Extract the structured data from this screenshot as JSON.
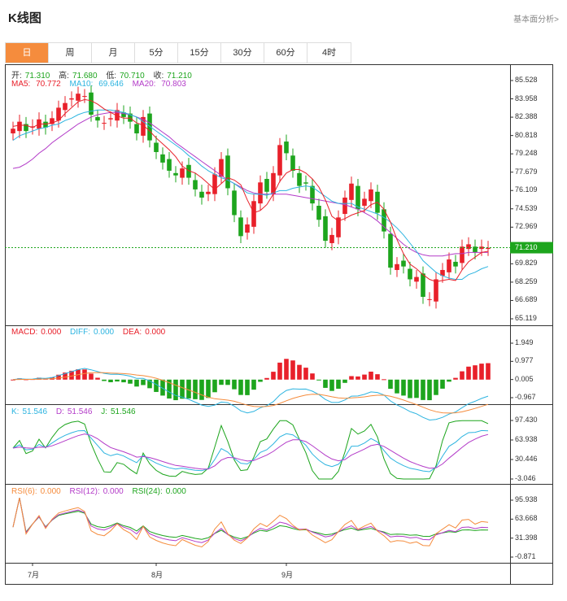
{
  "header": {
    "title": "K线图",
    "link": "基本面分析>"
  },
  "tabs": [
    "日",
    "周",
    "月",
    "5分",
    "15分",
    "30分",
    "60分",
    "4时"
  ],
  "active_tab": "日",
  "ohlc_info": {
    "open_label": "开:",
    "open": "71.310",
    "high_label": "高:",
    "high": "71.680",
    "low_label": "低:",
    "low": "70.710",
    "close_label": "收:",
    "close": "71.210"
  },
  "ma_info": {
    "ma5_label": "MA5:",
    "ma5": "70.772",
    "ma10_label": "MA10:",
    "ma10": "69.646",
    "ma20_label": "MA20:",
    "ma20": "70.803"
  },
  "macd_info": {
    "macd_label": "MACD:",
    "macd": "0.000",
    "diff_label": "DIFF:",
    "diff": "0.000",
    "dea_label": "DEA:",
    "dea": "0.000"
  },
  "kdj_info": {
    "k_label": "K:",
    "k": "51.546",
    "d_label": "D:",
    "d": "51.546",
    "j_label": "J:",
    "j": "51.546"
  },
  "rsi_info": {
    "rsi6_label": "RSI(6):",
    "rsi6": "0.000",
    "rsi12_label": "RSI(12):",
    "rsi12": "0.000",
    "rsi24_label": "RSI(24):",
    "rsi24": "0.000"
  },
  "price_axis": [
    "85.528",
    "83.958",
    "82.388",
    "80.818",
    "79.248",
    "77.679",
    "76.109",
    "74.539",
    "72.969",
    "69.829",
    "68.259",
    "66.689",
    "65.119"
  ],
  "current_price": "71.210",
  "macd_axis": [
    "1.949",
    "0.977",
    "0.005",
    "-0.967"
  ],
  "kdj_axis": [
    "97.430",
    "63.938",
    "30.446",
    "-3.046"
  ],
  "rsi_axis": [
    "95.938",
    "63.668",
    "31.398",
    "-0.871"
  ],
  "x_labels": [
    "7月",
    "8月",
    "9月"
  ],
  "colors": {
    "up": "#e8202a",
    "down": "#1da51d",
    "ma5": "#e8202a",
    "ma10": "#2db4e0",
    "ma20": "#b33bc8",
    "accent": "#f58c3d"
  },
  "chart_data": {
    "type": "candlestick",
    "close": [
      81.4,
      82.0,
      81.2,
      81.6,
      82.2,
      81.5,
      82.3,
      83.2,
      83.6,
      84.0,
      84.4,
      84.2,
      82.6,
      82.1,
      81.9,
      82.3,
      83.0,
      82.4,
      82.0,
      81.0,
      82.4,
      80.4,
      79.4,
      78.5,
      77.8,
      77.4,
      78.0,
      77.2,
      76.2,
      75.5,
      76.0,
      77.5,
      78.8,
      76.3,
      74.0,
      72.2,
      73.2,
      75.2,
      76.8,
      76.0,
      77.6,
      80.0,
      79.3,
      77.8,
      76.5,
      76.7,
      75.0,
      73.6,
      71.8,
      72.3,
      73.8,
      75.5,
      76.7,
      74.5,
      75.4,
      76.2,
      74.2,
      72.6,
      69.5,
      69.8,
      69.6,
      68.5,
      68.7,
      67.0,
      66.8,
      68.5,
      69.3,
      70.2,
      69.6,
      71.3,
      71.5,
      70.8,
      71.3,
      71.2
    ],
    "ma5": [
      81.6,
      81.7,
      81.7,
      81.5,
      81.8,
      81.8,
      81.9,
      82.1,
      82.7,
      83.2,
      83.7,
      83.9,
      83.8,
      83.5,
      83.1,
      82.8,
      82.5,
      82.3,
      82.3,
      81.9,
      81.7,
      81.2,
      80.6,
      80.1,
      79.6,
      79.0,
      78.2,
      77.8,
      77.6,
      77.2,
      76.7,
      76.2,
      76.7,
      77.2,
      77.0,
      76.6,
      75.3,
      74.2,
      74.4,
      74.9,
      75.8,
      76.9,
      77.6,
      77.9,
      77.9,
      77.6,
      77.1,
      76.4,
      75.3,
      73.9,
      73.5,
      73.7,
      74.0,
      74.2,
      74.4,
      74.9,
      75.1,
      74.5,
      73.4,
      71.9,
      70.7,
      69.8,
      69.4,
      68.9,
      68.5,
      68.3,
      68.4,
      68.5,
      68.4,
      69.3,
      70.0,
      70.4,
      70.8,
      70.9
    ],
    "ma10": [
      80.4,
      80.8,
      81.0,
      81.2,
      81.4,
      81.5,
      81.7,
      81.8,
      82.1,
      82.3,
      82.6,
      82.8,
      82.9,
      83.0,
      83.0,
      83.0,
      82.9,
      82.8,
      82.6,
      82.4,
      82.0,
      81.6,
      81.2,
      80.8,
      80.4,
      80.0,
      79.6,
      79.1,
      78.7,
      78.2,
      77.8,
      77.5,
      77.2,
      77.0,
      76.7,
      76.3,
      75.9,
      75.8,
      75.8,
      75.7,
      75.9,
      76.1,
      76.1,
      76.3,
      76.4,
      76.5,
      76.4,
      76.0,
      75.6,
      75.2,
      75.0,
      75.0,
      75.0,
      74.7,
      74.5,
      74.3,
      74.1,
      73.8,
      73.4,
      72.9,
      72.3,
      71.6,
      70.9,
      70.1,
      69.6,
      69.1,
      68.8,
      68.6,
      68.5,
      68.5,
      68.9,
      69.1,
      69.4,
      69.6
    ],
    "ma20": [
      78.0,
      78.1,
      78.4,
      78.8,
      79.3,
      79.7,
      80.2,
      80.6,
      81.0,
      81.4,
      81.8,
      82.1,
      82.4,
      82.6,
      82.7,
      82.8,
      82.8,
      82.7,
      82.6,
      82.4,
      82.2,
      81.9,
      81.5,
      81.1,
      80.7,
      80.2,
      79.8,
      79.4,
      79.0,
      78.6,
      78.2,
      77.8,
      77.4,
      77.0,
      76.7,
      76.4,
      76.1,
      75.9,
      75.8,
      75.8,
      75.8,
      75.8,
      75.8,
      75.7,
      75.6,
      75.5,
      75.4,
      75.3,
      75.2,
      75.1,
      75.0,
      74.9,
      74.7,
      74.5,
      74.2,
      73.9,
      73.5,
      73.0,
      72.5,
      72.0,
      71.5,
      71.1,
      70.8,
      70.6,
      70.5,
      70.5,
      70.5,
      70.6,
      70.7,
      70.7,
      70.8,
      70.8,
      70.8,
      70.8
    ]
  }
}
